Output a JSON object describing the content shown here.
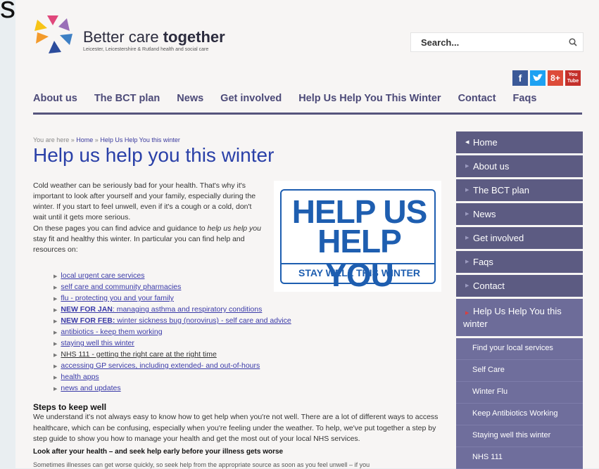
{
  "stray_text": "s",
  "logo": {
    "title_regular": "Better care ",
    "title_bold": "together",
    "subtitle": "Leicester, Leicestershire & Rutland health and social care"
  },
  "search": {
    "placeholder": "Search..."
  },
  "social": {
    "facebook": "f",
    "twitter": "t",
    "gplus": "8+",
    "youtube": "You Tube"
  },
  "nav": [
    "About us",
    "The BCT plan",
    "News",
    "Get involved",
    "Help Us Help You This Winter",
    "Contact",
    "Faqs"
  ],
  "breadcrumb": {
    "prefix": "You are here",
    "sep": "»",
    "home": "Home",
    "current": "Help Us Help You this winter"
  },
  "page_title": "Help us help you this winter",
  "intro1": "Cold weather can be seriously bad for your health. That's why it's important to look after yourself and your family, especially during the winter. If you start to feel unwell, even if it's a cough or a cold, don't wait until it gets more serious.",
  "intro2_a": "On these pages you can find advice and guidance to ",
  "intro2_em": "help us help you",
  "intro2_b": " stay fit and healthy this winter. In particular you can find help and resources on:",
  "hero": {
    "line1": "HELP US",
    "line2": "HELP YOU",
    "line3": "STAY WELL THIS WINTER"
  },
  "links": [
    {
      "bold": "",
      "text": "local urgent care services"
    },
    {
      "bold": "",
      "text": "self care and community pharmacies"
    },
    {
      "bold": "",
      "text": "flu - protecting you and your family"
    },
    {
      "bold": "NEW FOR JAN",
      "text": ": managing asthma and respiratory conditions"
    },
    {
      "bold": "NEW FOR FEB:",
      "text": " winter sickness bug (norovirus) - self care and advice"
    },
    {
      "bold": "",
      "text": "antibiotics - keep them working"
    },
    {
      "bold": "",
      "text": "staying well this winter"
    },
    {
      "bold": "",
      "text": "NHS 111 - getting the right care at the right time"
    },
    {
      "bold": "",
      "text": "accessing GP services, including extended- and out-of-hours"
    },
    {
      "bold": "",
      "text": "health apps"
    },
    {
      "bold": "",
      "text": "news and updates"
    }
  ],
  "steps_heading": "Steps to keep well",
  "steps_body": "We understand it's not always easy to know how to get help when you're not well. There are a lot of different ways to access healthcare, which can be confusing, especially when you're feeling under the weather. To help, we've put together a step by step guide to show you how to manage your health and get the most out of your local NHS services.",
  "look_heading": "Look after your health – and seek help early before your illness gets worse",
  "look_cut": "Sometimes illnesses can get worse quickly, so seek help from the appropriate source as soon as you feel unwell – if you",
  "sidebar": {
    "main": [
      "Home",
      "About us",
      "The BCT plan",
      "News",
      "Get involved",
      "Faqs",
      "Contact"
    ],
    "active": "Help Us Help You this winter",
    "sub": [
      "Find your local services",
      "Self Care",
      "Winter Flu",
      "Keep Antibiotics Working",
      "Staying well this winter",
      "NHS 111"
    ]
  }
}
